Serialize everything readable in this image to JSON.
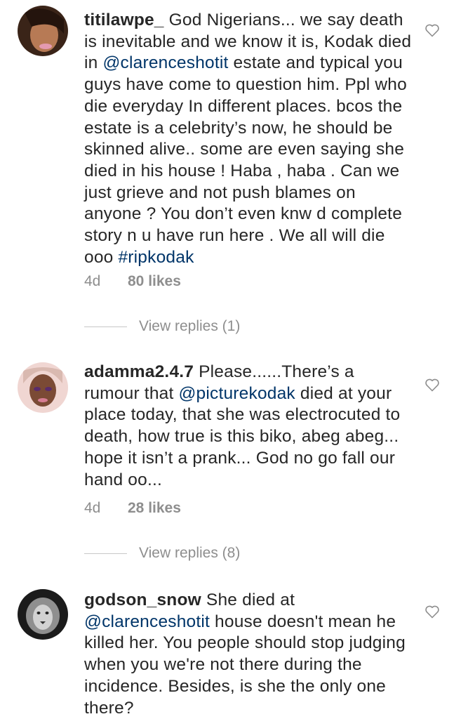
{
  "comments": [
    {
      "username": "titilawpe_",
      "text_parts": [
        {
          "t": " God Nigerians... we say death is inevitable and we know it is, Kodak died in "
        },
        {
          "m": "@clarenceshotit"
        },
        {
          "t": " estate and typical you guys have come to question him.  Ppl who die everyday In different places. bcos the estate is a celebrity’s now, he should be skinned alive.. some are even saying she died in his house ! Haba , haba . Can we just grieve and not push blames on anyone ? You don’t even knw d complete story n u have run here . We all will die ooo "
        },
        {
          "h": "#ripkodak"
        }
      ],
      "time": "4d",
      "likes": "80 likes",
      "replies": "View replies (1)"
    },
    {
      "username": "adamma2.4.7",
      "text_parts": [
        {
          "t": " Please......There’s  a rumour that "
        },
        {
          "m": "@picturekodak"
        },
        {
          "t": "  died at your place today, that she was electrocuted to death, how true is this biko, abeg abeg... hope it isn’t  a prank... God no go fall our hand oo..."
        }
      ],
      "time": "4d",
      "likes": "28 likes",
      "replies": "View replies (8)"
    },
    {
      "username": "godson_snow",
      "text_parts": [
        {
          "t": " She died at "
        },
        {
          "m": "@clarenceshotit"
        },
        {
          "t": " house doesn't mean he killed her. You people should stop judging when you we're not there during the incidence. Besides, is she the only one there?"
        }
      ]
    }
  ],
  "colors": {
    "mention": "#003569",
    "meta": "#8e8e8e",
    "text": "#262626"
  },
  "icons": {
    "like": "heart-outline-icon"
  }
}
